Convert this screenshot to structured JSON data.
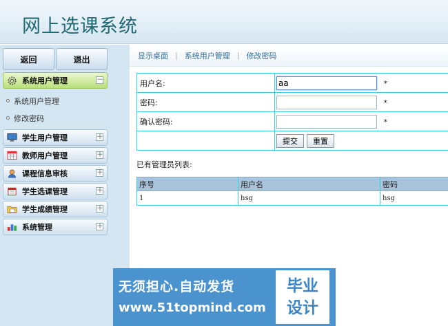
{
  "app": {
    "title": "网上选课系统"
  },
  "sidebar": {
    "back_label": "返回",
    "logout_label": "退出",
    "active_section": {
      "label": "系统用户管理",
      "icon": "gear-icon",
      "toggle": "－"
    },
    "sub_items": [
      "系统用户管理",
      "修改密码"
    ],
    "sections": [
      {
        "label": "学生用户管理",
        "icon": "monitor-icon",
        "toggle": "＋"
      },
      {
        "label": "教师用户管理",
        "icon": "calendar-icon",
        "toggle": "＋"
      },
      {
        "label": "课程信息审核",
        "icon": "user-icon",
        "toggle": "＋"
      },
      {
        "label": "学生选课管理",
        "icon": "calendar-red-icon",
        "toggle": "＋"
      },
      {
        "label": "学生成绩管理",
        "icon": "folder-icon",
        "toggle": "＋"
      },
      {
        "label": "系统管理",
        "icon": "chart-icon",
        "toggle": "＋"
      }
    ]
  },
  "breadcrumbs": [
    "显示桌面",
    "系统用户管理",
    "修改密码"
  ],
  "form": {
    "username_label": "用户名:",
    "username_value": "aa",
    "password_label": "密码:",
    "password_value": "",
    "confirm_label": "确认密码:",
    "confirm_value": "",
    "required_mark": "*",
    "submit_label": "提交",
    "reset_label": "重置"
  },
  "admin_list": {
    "label": "已有管理员列表:",
    "columns": [
      "序号",
      "用户名",
      "密码"
    ],
    "rows": [
      [
        "1",
        "hsg",
        "hsg"
      ]
    ]
  },
  "banner": {
    "line1": "无须担心.自动发货",
    "line2": "www.51topmind.com",
    "badge1": "毕业",
    "badge2": "设计"
  }
}
